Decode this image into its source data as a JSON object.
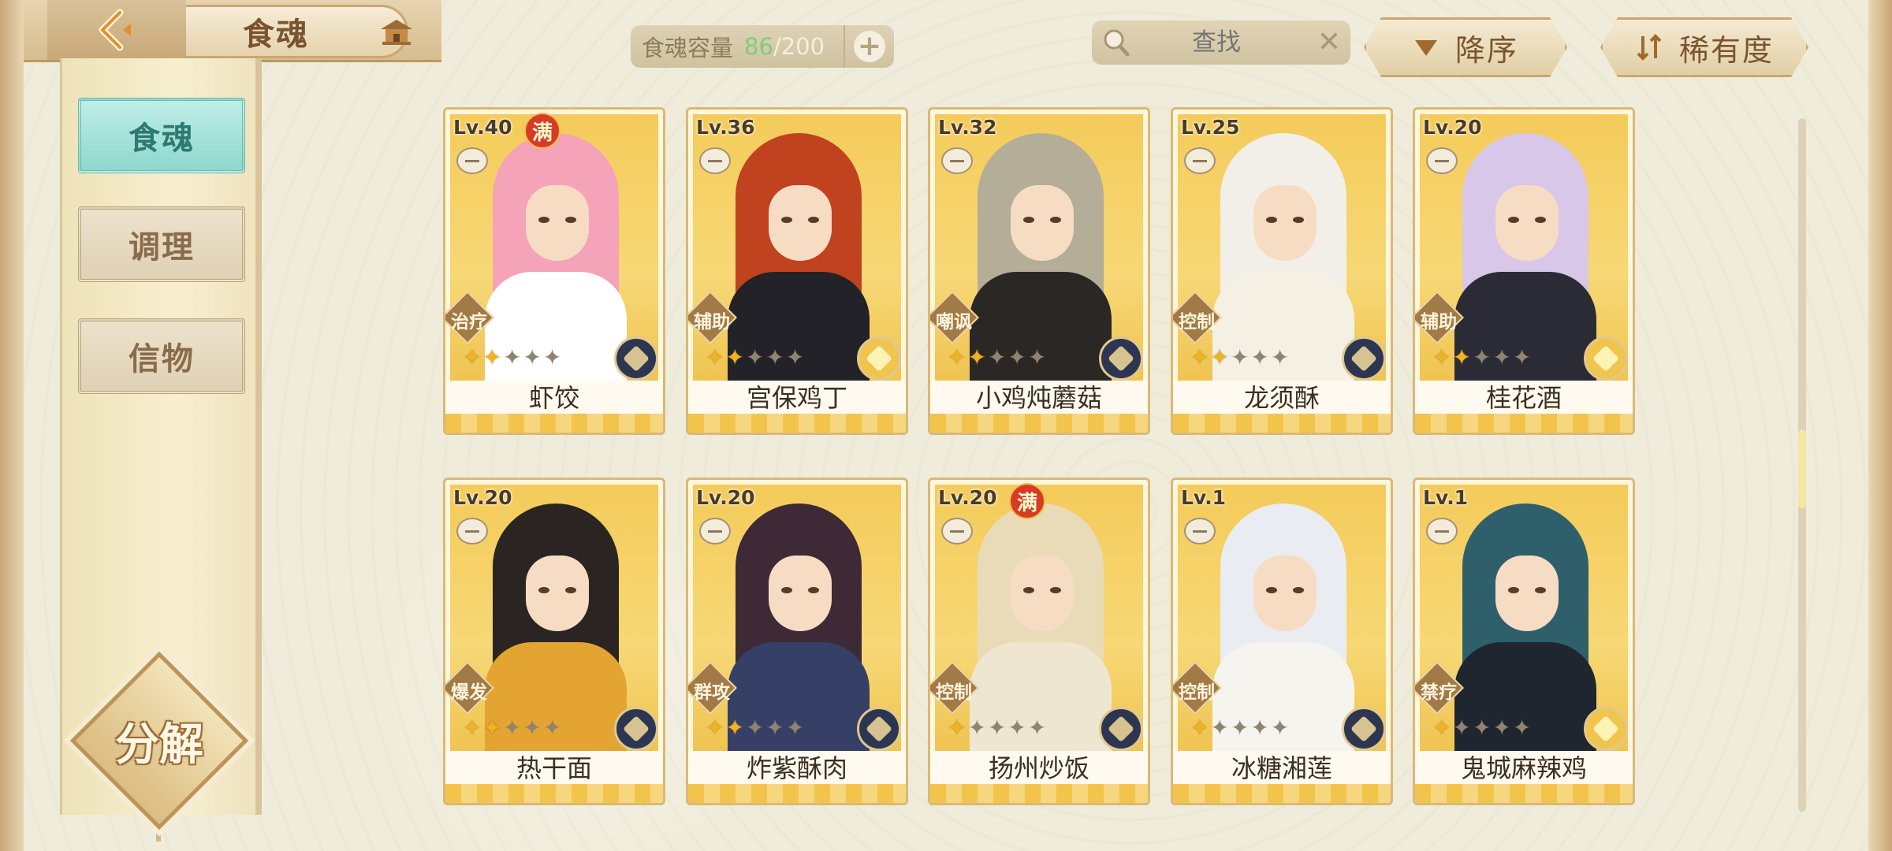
{
  "header": {
    "title": "食魂",
    "capacity_label": "食魂容量",
    "capacity_current": "86",
    "capacity_max": "/200",
    "plus_label": "+",
    "search_placeholder": "查找",
    "clear_label": "✕",
    "sort_label": "降序",
    "rarity_label": "稀有度"
  },
  "sidebar": {
    "items": [
      {
        "label": "食魂",
        "active": true
      },
      {
        "label": "调理",
        "active": false
      },
      {
        "label": "信物",
        "active": false
      }
    ],
    "decompose_label": "分解"
  },
  "colors": {
    "accent_teal": "#8ed7cd",
    "gold": "#f0b323",
    "card_border": "#d8b977"
  },
  "cards": [
    {
      "level": "Lv.40",
      "name": "虾饺",
      "role": "治疗",
      "stars": 2,
      "max": true,
      "emblem": "blue",
      "hair": "#f5a3b8",
      "body": "#ffffff"
    },
    {
      "level": "Lv.36",
      "name": "宫保鸡丁",
      "role": "辅助",
      "stars": 2,
      "max": false,
      "emblem": "gold",
      "hair": "#c0421f",
      "body": "#222228"
    },
    {
      "level": "Lv.32",
      "name": "小鸡炖蘑菇",
      "role": "嘲讽",
      "stars": 2,
      "max": false,
      "emblem": "blue",
      "hair": "#b4ad97",
      "body": "#2a2724"
    },
    {
      "level": "Lv.25",
      "name": "龙须酥",
      "role": "控制",
      "stars": 2,
      "max": false,
      "emblem": "blue",
      "hair": "#f1efe8",
      "body": "#f4f0e4"
    },
    {
      "level": "Lv.20",
      "name": "桂花酒",
      "role": "辅助",
      "stars": 2,
      "max": false,
      "emblem": "gold",
      "hair": "#d9c7ea",
      "body": "#2b2b35"
    },
    {
      "level": "Lv.20",
      "name": "热干面",
      "role": "爆发",
      "stars": 2,
      "max": false,
      "emblem": "blue",
      "hair": "#2a2522",
      "body": "#e3a431"
    },
    {
      "level": "Lv.20",
      "name": "炸紫酥肉",
      "role": "群攻",
      "stars": 2,
      "max": false,
      "emblem": "blue",
      "hair": "#3d2a36",
      "body": "#364066"
    },
    {
      "level": "Lv.20",
      "name": "扬州炒饭",
      "role": "控制",
      "stars": 1,
      "max": true,
      "emblem": "blue",
      "hair": "#eadbb8",
      "body": "#efe6d2"
    },
    {
      "level": "Lv.1",
      "name": "冰糖湘莲",
      "role": "控制",
      "stars": 1,
      "max": false,
      "emblem": "blue",
      "hair": "#e9ecf1",
      "body": "#f6f4ef"
    },
    {
      "level": "Lv.1",
      "name": "鬼城麻辣鸡",
      "role": "禁疗",
      "stars": 1,
      "max": false,
      "emblem": "gold",
      "hair": "#2e5f6b",
      "body": "#1f2630"
    }
  ],
  "max_badge_label": "满",
  "star_total": 5
}
